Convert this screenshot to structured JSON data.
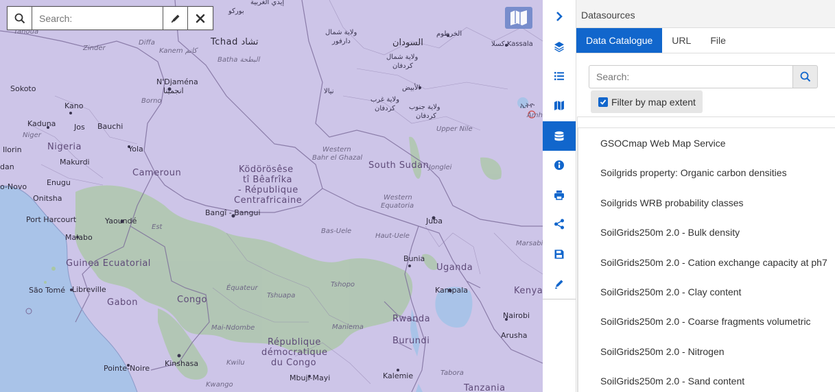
{
  "map": {
    "search_placeholder": "Search:",
    "labels": {
      "tahoua": "Tahoua",
      "zinder": "Zinder",
      "diffa": "Diffa",
      "kanem": "Kanem كانم",
      "tchad": "Tchad تشاد",
      "batha": "Batha البطحة",
      "ndjamena": "N'Djaména",
      "ndjamena_ar": "انجمينا",
      "borno": "Borno",
      "sokoto": "Sokoto",
      "kano": "Kano",
      "kaduna": "Kaduna",
      "jos": "Jos",
      "bauchi": "Bauchi",
      "niger_state": "Niger",
      "ilorin": "Ilorin",
      "nigeria": "Nigeria",
      "yola": "Yola",
      "makurdi": "Makurdi",
      "dan": "dan",
      "cameroun": "Cameroun",
      "enugu": "Enugu",
      "onitsha": "Onitsha",
      "o_novo": "o-Novo",
      "port_harcourt": "Port Harcourt",
      "yaounde": "Yaoundé",
      "malabo": "Malabo",
      "est": "Est",
      "guinea_ecuatorial": "Guinea Ecuatorial",
      "sao_tome": "São Tomé",
      "libreville": "Libreville",
      "gabon": "Gabon",
      "congo": "Congo",
      "pointe_noire": "Pointe-Noire",
      "kinshasa": "Kinshasa",
      "kwilu": "Kwilu",
      "kwango": "Kwango",
      "car1": "Ködörösêse",
      "car2": "tî Bêafrîka",
      "car3": "- République",
      "car4": "Centrafricaine",
      "bangui": "Bangî - Bangui",
      "equateur": "Équateur",
      "tshuapa": "Tshuapa",
      "tshopo": "Tshopo",
      "mai_ndombe": "Mai-Ndombe",
      "maniema": "Maniema",
      "rdc1": "République",
      "rdc2": "démocratique",
      "rdc3": "du Congo",
      "mbuji_mayi": "Mbuji-Mayi",
      "kalemie": "Kalemie",
      "tabora": "Tabora",
      "tanzania": "Tanzania",
      "bas_uele": "Bas-Uele",
      "haut_uele": "Haut-Uele",
      "bunia": "Bunia",
      "uganda": "Uganda",
      "kampala": "Kampala",
      "rwanda": "Rwanda",
      "burundi": "Burundi",
      "kenya": "Kenya",
      "nairobi": "Nairobi",
      "arusha": "Arusha",
      "marsabit": "Marsabit",
      "juba": "Juba",
      "western_equatoria1": "Western",
      "western_equatoria2": "Equatoria",
      "south_sudan": "South Sudan",
      "jonglei": "Jonglei",
      "western_bahr1": "Western",
      "western_bahr2": "Bahr el Ghazal",
      "upper_nile": "Upper Nile",
      "sudan_ar": "السودان",
      "khartoum_ar": "الخرطوم",
      "obeid_ar": "الأبيض",
      "nyala_ar": "نيالا",
      "kassala": "كسلا Kassala",
      "north_darfur": "ولاية شمال",
      "north_darfur2": "دارفور",
      "north_kordofan": "ولاية شمال",
      "north_kordofan2": "كردفان",
      "west_kordofan": "ولاية غرب",
      "west_kordofan2": "كردفان",
      "south_kordofan": "ولاية جنوب",
      "south_kordofan2": "كردفان",
      "borkou": "بوركو",
      "ennedi": "إيدي الغربية",
      "amhara": "Amhar",
      "ethiopia_ar": "ኢትዮ"
    }
  },
  "rail": {
    "items": [
      "chevron-right-icon",
      "layers-icon",
      "legend-list-icon",
      "basemap-icon",
      "datasources-icon",
      "info-icon",
      "print-icon",
      "share-icon",
      "save-icon",
      "draw-icon"
    ],
    "active_index": 4,
    "accent": "#1166cc"
  },
  "panel": {
    "title": "Datasources",
    "tabs": [
      {
        "label": "Data Catalogue",
        "active": true
      },
      {
        "label": "URL",
        "active": false
      },
      {
        "label": "File",
        "active": false
      }
    ],
    "search_placeholder": "Search:",
    "filter_label": "Filter by map extent",
    "filter_checked": true,
    "datasets": [
      "GSOCmap Web Map Service",
      "Soilgrids property: Organic carbon densities",
      "Soilgrids WRB probability classes",
      "SoilGrids250m 2.0 - Bulk density",
      "SoilGrids250m 2.0 - Cation exchange capacity at ph7",
      "SoilGrids250m 2.0 - Clay content",
      "SoilGrids250m 2.0 - Coarse fragments volumetric",
      "SoilGrids250m 2.0 - Nitrogen",
      "SoilGrids250m 2.0 - Sand content"
    ]
  }
}
